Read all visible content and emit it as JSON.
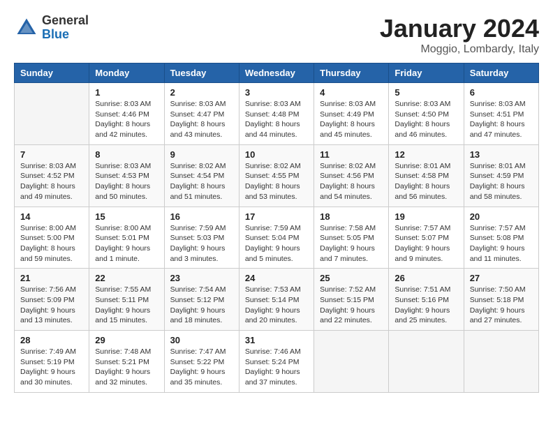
{
  "header": {
    "logo_general": "General",
    "logo_blue": "Blue",
    "title": "January 2024",
    "location": "Moggio, Lombardy, Italy"
  },
  "days_of_week": [
    "Sunday",
    "Monday",
    "Tuesday",
    "Wednesday",
    "Thursday",
    "Friday",
    "Saturday"
  ],
  "weeks": [
    [
      {
        "num": "",
        "info": ""
      },
      {
        "num": "1",
        "info": "Sunrise: 8:03 AM\nSunset: 4:46 PM\nDaylight: 8 hours\nand 42 minutes."
      },
      {
        "num": "2",
        "info": "Sunrise: 8:03 AM\nSunset: 4:47 PM\nDaylight: 8 hours\nand 43 minutes."
      },
      {
        "num": "3",
        "info": "Sunrise: 8:03 AM\nSunset: 4:48 PM\nDaylight: 8 hours\nand 44 minutes."
      },
      {
        "num": "4",
        "info": "Sunrise: 8:03 AM\nSunset: 4:49 PM\nDaylight: 8 hours\nand 45 minutes."
      },
      {
        "num": "5",
        "info": "Sunrise: 8:03 AM\nSunset: 4:50 PM\nDaylight: 8 hours\nand 46 minutes."
      },
      {
        "num": "6",
        "info": "Sunrise: 8:03 AM\nSunset: 4:51 PM\nDaylight: 8 hours\nand 47 minutes."
      }
    ],
    [
      {
        "num": "7",
        "info": "Sunrise: 8:03 AM\nSunset: 4:52 PM\nDaylight: 8 hours\nand 49 minutes."
      },
      {
        "num": "8",
        "info": "Sunrise: 8:03 AM\nSunset: 4:53 PM\nDaylight: 8 hours\nand 50 minutes."
      },
      {
        "num": "9",
        "info": "Sunrise: 8:02 AM\nSunset: 4:54 PM\nDaylight: 8 hours\nand 51 minutes."
      },
      {
        "num": "10",
        "info": "Sunrise: 8:02 AM\nSunset: 4:55 PM\nDaylight: 8 hours\nand 53 minutes."
      },
      {
        "num": "11",
        "info": "Sunrise: 8:02 AM\nSunset: 4:56 PM\nDaylight: 8 hours\nand 54 minutes."
      },
      {
        "num": "12",
        "info": "Sunrise: 8:01 AM\nSunset: 4:58 PM\nDaylight: 8 hours\nand 56 minutes."
      },
      {
        "num": "13",
        "info": "Sunrise: 8:01 AM\nSunset: 4:59 PM\nDaylight: 8 hours\nand 58 minutes."
      }
    ],
    [
      {
        "num": "14",
        "info": "Sunrise: 8:00 AM\nSunset: 5:00 PM\nDaylight: 8 hours\nand 59 minutes."
      },
      {
        "num": "15",
        "info": "Sunrise: 8:00 AM\nSunset: 5:01 PM\nDaylight: 9 hours\nand 1 minute."
      },
      {
        "num": "16",
        "info": "Sunrise: 7:59 AM\nSunset: 5:03 PM\nDaylight: 9 hours\nand 3 minutes."
      },
      {
        "num": "17",
        "info": "Sunrise: 7:59 AM\nSunset: 5:04 PM\nDaylight: 9 hours\nand 5 minutes."
      },
      {
        "num": "18",
        "info": "Sunrise: 7:58 AM\nSunset: 5:05 PM\nDaylight: 9 hours\nand 7 minutes."
      },
      {
        "num": "19",
        "info": "Sunrise: 7:57 AM\nSunset: 5:07 PM\nDaylight: 9 hours\nand 9 minutes."
      },
      {
        "num": "20",
        "info": "Sunrise: 7:57 AM\nSunset: 5:08 PM\nDaylight: 9 hours\nand 11 minutes."
      }
    ],
    [
      {
        "num": "21",
        "info": "Sunrise: 7:56 AM\nSunset: 5:09 PM\nDaylight: 9 hours\nand 13 minutes."
      },
      {
        "num": "22",
        "info": "Sunrise: 7:55 AM\nSunset: 5:11 PM\nDaylight: 9 hours\nand 15 minutes."
      },
      {
        "num": "23",
        "info": "Sunrise: 7:54 AM\nSunset: 5:12 PM\nDaylight: 9 hours\nand 18 minutes."
      },
      {
        "num": "24",
        "info": "Sunrise: 7:53 AM\nSunset: 5:14 PM\nDaylight: 9 hours\nand 20 minutes."
      },
      {
        "num": "25",
        "info": "Sunrise: 7:52 AM\nSunset: 5:15 PM\nDaylight: 9 hours\nand 22 minutes."
      },
      {
        "num": "26",
        "info": "Sunrise: 7:51 AM\nSunset: 5:16 PM\nDaylight: 9 hours\nand 25 minutes."
      },
      {
        "num": "27",
        "info": "Sunrise: 7:50 AM\nSunset: 5:18 PM\nDaylight: 9 hours\nand 27 minutes."
      }
    ],
    [
      {
        "num": "28",
        "info": "Sunrise: 7:49 AM\nSunset: 5:19 PM\nDaylight: 9 hours\nand 30 minutes."
      },
      {
        "num": "29",
        "info": "Sunrise: 7:48 AM\nSunset: 5:21 PM\nDaylight: 9 hours\nand 32 minutes."
      },
      {
        "num": "30",
        "info": "Sunrise: 7:47 AM\nSunset: 5:22 PM\nDaylight: 9 hours\nand 35 minutes."
      },
      {
        "num": "31",
        "info": "Sunrise: 7:46 AM\nSunset: 5:24 PM\nDaylight: 9 hours\nand 37 minutes."
      },
      {
        "num": "",
        "info": ""
      },
      {
        "num": "",
        "info": ""
      },
      {
        "num": "",
        "info": ""
      }
    ]
  ]
}
